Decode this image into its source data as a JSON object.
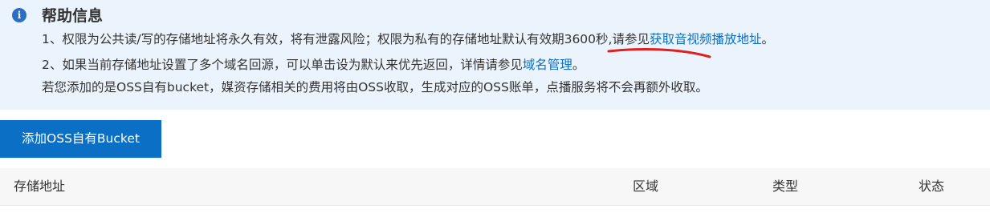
{
  "help": {
    "icon": "info-icon",
    "icon_glyph": "i",
    "title": "帮助信息",
    "line1": {
      "text_before": "1、权限为公共读/写的存储地址将永久有效，将有泄露风险；权限为私有的存储地址默认有效期3600秒,请参见",
      "link": "获取音视频播放地址",
      "text_after": "。"
    },
    "line2": {
      "text_before": "2、如果当前存储地址设置了多个域名回源，可以单击设为默认来优先返回，详情请参见",
      "link": "域名管理",
      "text_after": "。"
    },
    "line3": "若您添加的是OSS自有bucket，媒资存储相关的费用将由OSS收取，生成对应的OSS账单，点播服务将不会再额外收取。"
  },
  "toolbar": {
    "add_button_label": "添加OSS自有Bucket"
  },
  "table": {
    "columns": [
      "存储地址",
      "区域",
      "类型",
      "状态"
    ]
  },
  "colors": {
    "help_background": "#ebf4fd",
    "accent": "#0b6fc6",
    "annotation": "#e02020"
  }
}
